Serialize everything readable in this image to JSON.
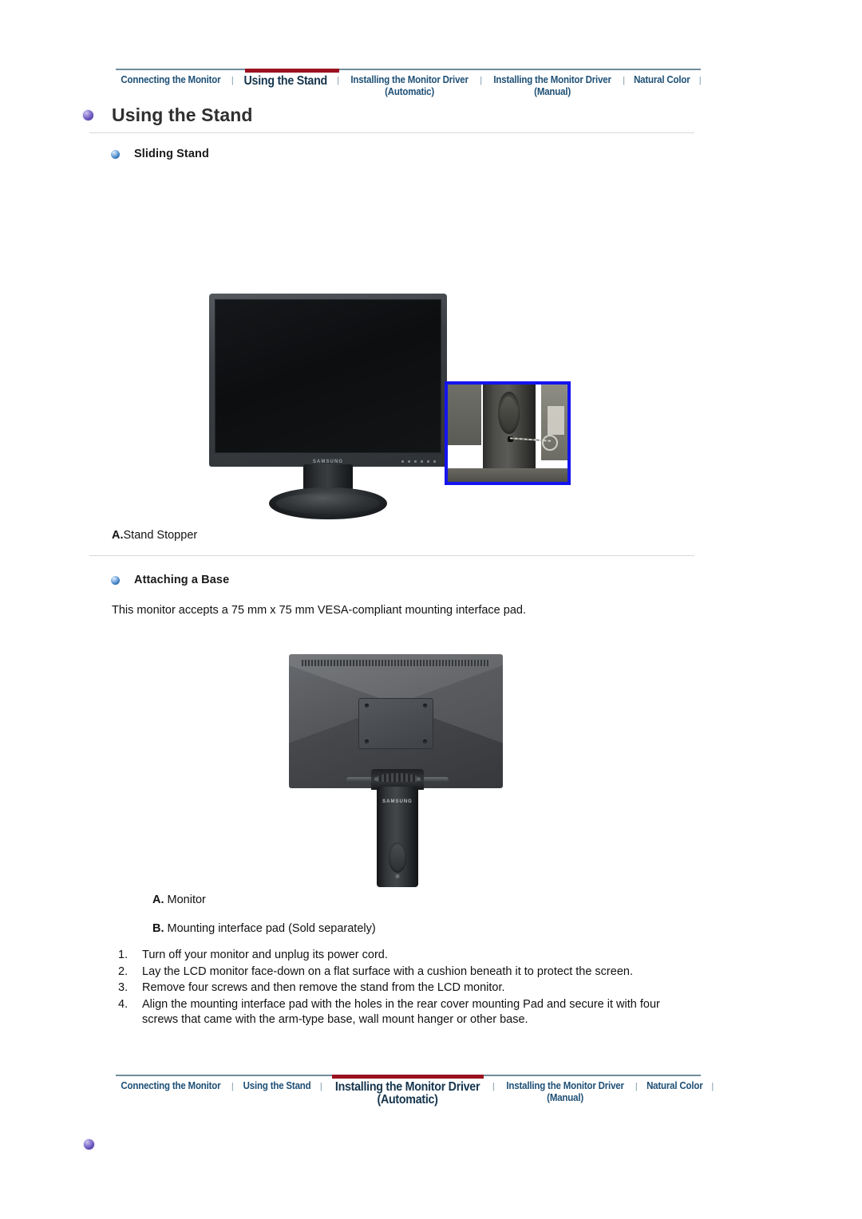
{
  "top_nav": {
    "items": [
      {
        "label": "Connecting the Monitor",
        "sub": "",
        "active": false
      },
      {
        "label": "Using the Stand",
        "sub": "",
        "active": true
      },
      {
        "label": "Installing the Monitor Driver",
        "sub": "(Automatic)",
        "active": false
      },
      {
        "label": "Installing the Monitor Driver",
        "sub": "(Manual)",
        "active": false
      },
      {
        "label": "Natural Color",
        "sub": "",
        "active": false
      }
    ],
    "separator": "|"
  },
  "bottom_nav": {
    "items": [
      {
        "label": "Connecting the Monitor",
        "sub": "",
        "active": false
      },
      {
        "label": "Using the Stand",
        "sub": "",
        "active": false
      },
      {
        "label": "Installing the Monitor Driver",
        "sub": "(Automatic)",
        "active": true
      },
      {
        "label": "Installing the Monitor Driver",
        "sub": "(Manual)",
        "active": false
      },
      {
        "label": "Natural Color",
        "sub": "",
        "active": false
      }
    ],
    "separator": "|"
  },
  "page": {
    "title": "Using the Stand"
  },
  "sections": {
    "sliding_stand": {
      "heading": "Sliding Stand",
      "caption_label": "A.",
      "caption_text": "Stand Stopper"
    },
    "attaching_base": {
      "heading": "Attaching a Base",
      "intro": "This monitor accepts a 75 mm x 75 mm VESA-compliant mounting interface pad.",
      "label_a_bold": "A.",
      "label_a_text": " Monitor",
      "label_b_bold": "B.",
      "label_b_text": " Mounting interface pad (Sold separately)",
      "steps": [
        {
          "num": "1.",
          "text": "Turn off your monitor and unplug its power cord."
        },
        {
          "num": "2.",
          "text": "Lay the LCD monitor face-down on a flat surface with a cushion beneath it to protect the screen."
        },
        {
          "num": "3.",
          "text": "Remove four screws and then remove the stand from the LCD monitor."
        },
        {
          "num": "4.",
          "text": "Align the mounting interface pad with the holes in the rear cover mounting Pad and secure it with four screws that came with the arm-type base, wall mount hanger or other base."
        }
      ]
    }
  },
  "figures": {
    "front_monitor": {
      "brand": "SAMSUNG"
    },
    "rear_monitor": {
      "brand": "SAMSUNG"
    }
  },
  "colors": {
    "nav_text": "#1f5076",
    "nav_active_text": "#16354d",
    "nav_rule": "#6f8d9c",
    "accent_red": "#9b1220",
    "inset_border": "#1414ef",
    "divider": "#d8d8d8",
    "title_text": "#2f2f2f"
  }
}
